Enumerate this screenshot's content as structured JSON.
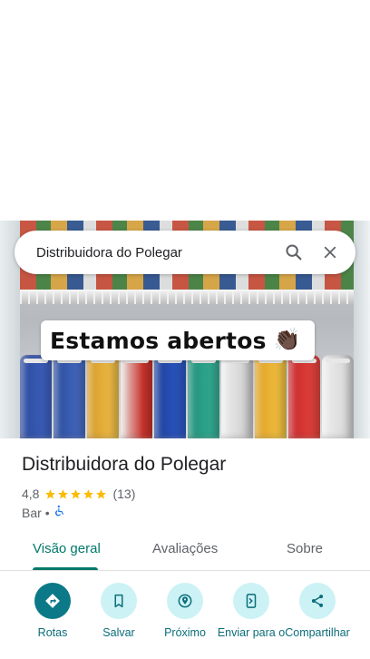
{
  "place": {
    "search_text": "Distribuidora do Polegar",
    "name": "Distribuidora do Polegar",
    "rating": "4,8",
    "review_count": "(13)",
    "stars": 5,
    "category": "Bar",
    "separator": "•"
  },
  "photo": {
    "banner_text": "Estamos abertos",
    "banner_emoji": "👏🏿"
  },
  "icons": {
    "search": "search-icon",
    "close": "close-icon",
    "accessibility": "wheelchair-icon",
    "directions": "directions-icon",
    "save": "bookmark-icon",
    "nearby": "nearby-icon",
    "send": "send-to-phone-icon",
    "share": "share-icon"
  },
  "tabs": [
    {
      "label": "Visão geral",
      "active": true
    },
    {
      "label": "Avaliações",
      "active": false
    },
    {
      "label": "Sobre",
      "active": false
    }
  ],
  "actions": [
    {
      "label": "Rotas"
    },
    {
      "label": "Salvar"
    },
    {
      "label": "Próximo"
    },
    {
      "label": "Enviar para o"
    },
    {
      "label": "Compartilhar"
    }
  ],
  "colors": {
    "accent": "#00796b",
    "action_bg": "#ccf2f5",
    "primary_action": "#0b7987",
    "star": "#fbbc04"
  }
}
